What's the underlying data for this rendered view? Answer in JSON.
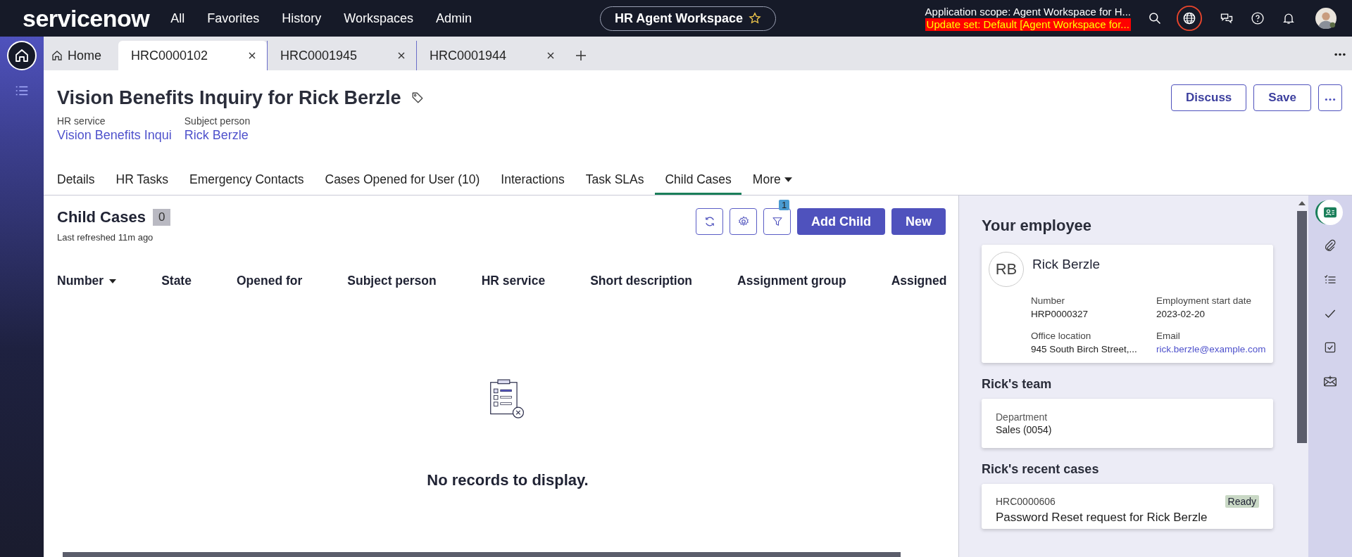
{
  "brand": "servicenow",
  "nav": [
    "All",
    "Favorites",
    "History",
    "Workspaces",
    "Admin"
  ],
  "workspace_button": {
    "label": "HR Agent Workspace"
  },
  "scope": {
    "application": "Application scope: Agent Workspace for H...",
    "update_set": "Update set: Default [Agent Workspace for..."
  },
  "tabs": [
    {
      "label": "Home",
      "kind": "home",
      "selected": false
    },
    {
      "label": "HRC0000102",
      "kind": "record",
      "selected": true
    },
    {
      "label": "HRC0001945",
      "kind": "record",
      "selected": false
    },
    {
      "label": "HRC0001944",
      "kind": "record",
      "selected": false
    }
  ],
  "record": {
    "title": "Vision Benefits Inquiry for Rick Berzle",
    "fields": [
      {
        "label": "HR service",
        "value": "Vision Benefits Inqui"
      },
      {
        "label": "Subject person",
        "value": "Rick Berzle"
      }
    ],
    "actions": [
      "Discuss",
      "Save"
    ]
  },
  "record_tabs": [
    {
      "label": "Details",
      "kind": "tab",
      "selected": false
    },
    {
      "label": "HR Tasks",
      "kind": "tab",
      "selected": false
    },
    {
      "label": "Emergency Contacts",
      "kind": "tab",
      "selected": false
    },
    {
      "label": "Cases Opened for User (10)",
      "kind": "tab",
      "selected": false
    },
    {
      "label": "Interactions",
      "kind": "tab",
      "selected": false
    },
    {
      "label": "Task SLAs",
      "kind": "tab",
      "selected": false
    },
    {
      "label": "Child Cases",
      "kind": "tab",
      "selected": true
    },
    {
      "label": "More",
      "kind": "menu",
      "selected": false
    }
  ],
  "related_list": {
    "title": "Child Cases",
    "count": "0",
    "refreshed": "Last refreshed 11m ago",
    "filter_count": "1",
    "buttons": [
      "Add Child",
      "New"
    ],
    "columns": [
      {
        "label": "Number",
        "sorted": true
      },
      {
        "label": "State",
        "sorted": false
      },
      {
        "label": "Opened for",
        "sorted": false
      },
      {
        "label": "Subject person",
        "sorted": false
      },
      {
        "label": "HR service",
        "sorted": false
      },
      {
        "label": "Short description",
        "sorted": false
      },
      {
        "label": "Assignment group",
        "sorted": false
      },
      {
        "label": "Assigned",
        "sorted": false
      }
    ],
    "empty_message": "No records to display."
  },
  "side_panel": {
    "employee": {
      "heading": "Your employee",
      "initials": "RB",
      "name": "Rick Berzle",
      "fields": [
        {
          "label": "Number",
          "value": "HRP0000327",
          "kind": "text"
        },
        {
          "label": "Employment start date",
          "value": "2023-02-20",
          "kind": "text"
        },
        {
          "label": "Office location",
          "value": "945 South Birch Street,...",
          "kind": "text"
        },
        {
          "label": "Email",
          "value": "rick.berzle@example.com",
          "kind": "link"
        }
      ]
    },
    "team": {
      "heading": "Rick's team",
      "label": "Department",
      "value": "Sales (0054)"
    },
    "recent": {
      "heading": "Rick's recent cases",
      "cases": [
        {
          "number": "HRC0000606",
          "state": "Ready",
          "title": "Password Reset request for Rick Berzle"
        }
      ]
    }
  },
  "side_tools": [
    {
      "kind": "contact",
      "selected": true
    },
    {
      "kind": "attachment",
      "selected": false
    },
    {
      "kind": "checklist",
      "selected": false
    },
    {
      "kind": "check",
      "selected": false
    },
    {
      "kind": "checkbox",
      "selected": false
    },
    {
      "kind": "mail",
      "selected": false
    }
  ]
}
